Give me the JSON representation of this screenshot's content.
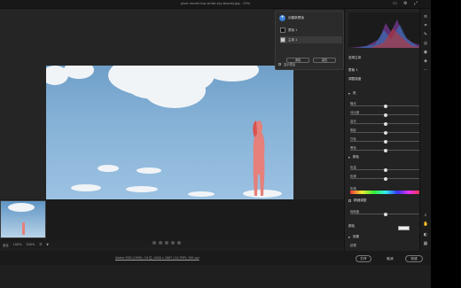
{
  "window": {
    "title": "pixel-model-lisa-white-sky-beauty.jpg - 29%"
  },
  "mask_panel": {
    "title": "创建新蒙版",
    "items": [
      {
        "label": "蒙版 1"
      },
      {
        "label": "主体 1"
      }
    ],
    "buttons": [
      "添加",
      "减去"
    ],
    "overlay_label": "显示叠加"
  },
  "right_panel": {
    "subject_label": "选择主体",
    "edit_label": "编辑",
    "mask_name": "蒙版 1",
    "amount_label": "调整强度",
    "light_section": "亮",
    "light_sliders": [
      {
        "label": "曝光",
        "value": "0.00",
        "pos": 0.5
      },
      {
        "label": "对比度",
        "value": "0",
        "pos": 0.5
      },
      {
        "label": "高光",
        "value": "0",
        "pos": 0.5
      },
      {
        "label": "阴影",
        "value": "0",
        "pos": 0.5
      },
      {
        "label": "白色",
        "value": "0",
        "pos": 0.5
      },
      {
        "label": "黑色",
        "value": "0",
        "pos": 0.5
      }
    ],
    "color_section": "颜色",
    "color_sliders": [
      {
        "label": "色温",
        "value": "0",
        "pos": 0.5
      },
      {
        "label": "色调",
        "value": "0",
        "pos": 0.5
      }
    ],
    "hue_label": "色相",
    "hue_value": "0.0",
    "fine_adjust": "精细调整",
    "saturation_label": "饱和度",
    "saturation_value": "0",
    "color_label": "颜色",
    "effects_section": "效果",
    "texture_label": "纹理",
    "texture_value": "0"
  },
  "status": {
    "zoom_a": "适合",
    "zoom_b": "100%",
    "zoom_c": "200%"
  },
  "file_info": "Adobe RGB (1998); 16 位; 4000 x 2667 (10.7MP); 300 ppi",
  "buttons": {
    "open": "打开",
    "cancel": "取消",
    "done": "完成"
  }
}
